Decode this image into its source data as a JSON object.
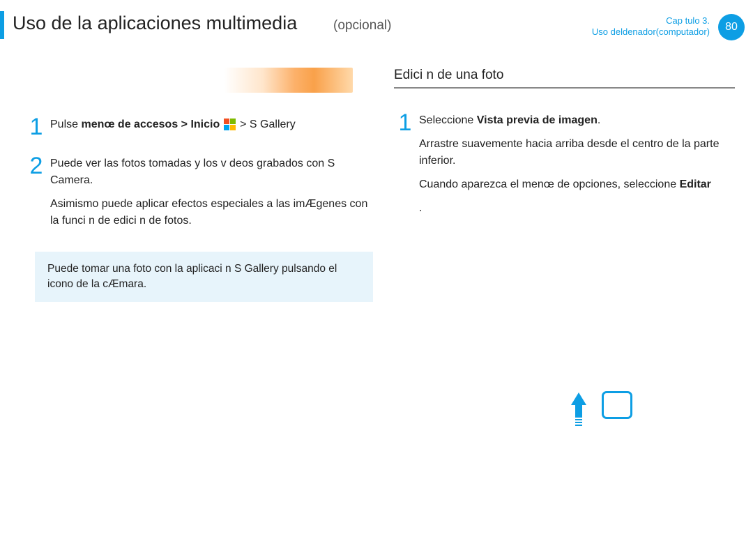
{
  "header": {
    "title": "Uso de la aplicaciones multimedia",
    "subtitle": "(opcional)",
    "chapter_line1": "Cap tulo 3.",
    "chapter_line2": "Uso deldenador(computador)",
    "page_number": "80"
  },
  "left": {
    "step1": {
      "num": "1",
      "prefix": "Pulse",
      "bold": "menœ de accesos > Inicio",
      "suffix": " > S Gallery"
    },
    "step2": {
      "num": "2",
      "p1": "Puede ver las fotos tomadas y los v deos grabados con S Camera.",
      "p2": "Asimismo puede aplicar efectos especiales a las imÆgenes con la funci n de edici n de fotos."
    },
    "note": "Puede tomar una foto con la aplicaci n S Gallery pulsando el icono de la cÆmara."
  },
  "right": {
    "section_title": "Edici n de una foto",
    "step1": {
      "num": "1",
      "p1a": "Seleccione",
      "p1b": "Vista previa de imagen",
      "p1c": ".",
      "p2": "Arrastre suavemente hacia arriba desde el centro de la parte inferior.",
      "p3_prefix": "Cuando aparezca el menœ de opciones, seleccione ",
      "p3_bold": "Editar",
      "p3_suffix": "."
    }
  }
}
